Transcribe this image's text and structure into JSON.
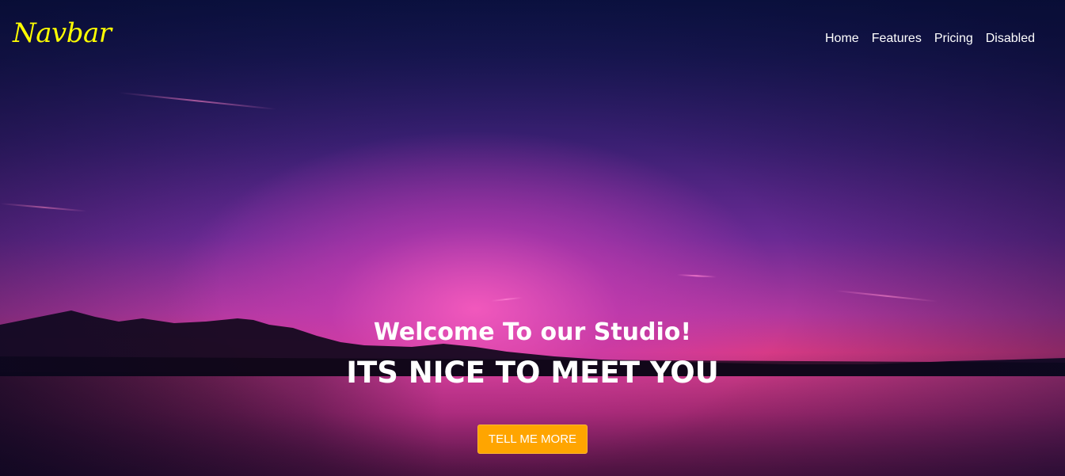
{
  "navbar": {
    "brand": "Navbar",
    "links": [
      {
        "label": "Home"
      },
      {
        "label": "Features"
      },
      {
        "label": "Pricing"
      },
      {
        "label": "Disabled"
      }
    ]
  },
  "hero": {
    "welcome": "Welcome To our Studio!",
    "headline": "ITS NICE TO MEET YOU",
    "cta_label": "TELL ME MORE"
  },
  "colors": {
    "brand": "#ffff00",
    "cta_background": "#ffa500",
    "text": "#ffffff"
  }
}
